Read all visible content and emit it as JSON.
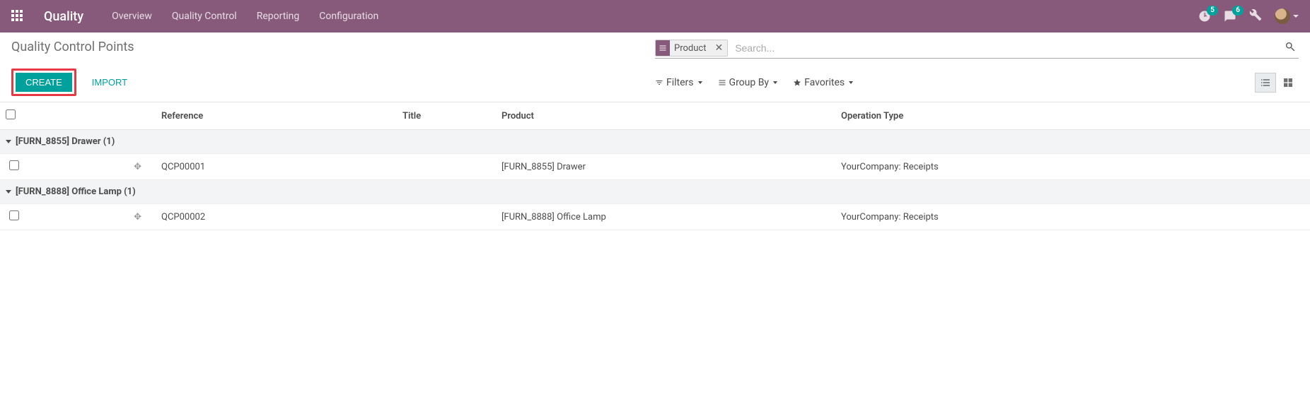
{
  "navbar": {
    "brand": "Quality",
    "links": [
      "Overview",
      "Quality Control",
      "Reporting",
      "Configuration"
    ],
    "activity_count": "5",
    "message_count": "6"
  },
  "breadcrumb": "Quality Control Points",
  "search": {
    "facet_label": "Product",
    "placeholder": "Search..."
  },
  "buttons": {
    "create": "Create",
    "import": "Import"
  },
  "tools": {
    "filters": "Filters",
    "groupby": "Group By",
    "favorites": "Favorites"
  },
  "columns": {
    "reference": "Reference",
    "title": "Title",
    "product": "Product",
    "operation_type": "Operation Type"
  },
  "groups": [
    {
      "label": "[FURN_8855] Drawer (1)",
      "rows": [
        {
          "reference": "QCP00001",
          "title": "",
          "product": "[FURN_8855] Drawer",
          "operation_type": "YourCompany: Receipts"
        }
      ]
    },
    {
      "label": "[FURN_8888] Office Lamp (1)",
      "rows": [
        {
          "reference": "QCP00002",
          "title": "",
          "product": "[FURN_8888] Office Lamp",
          "operation_type": "YourCompany: Receipts"
        }
      ]
    }
  ]
}
